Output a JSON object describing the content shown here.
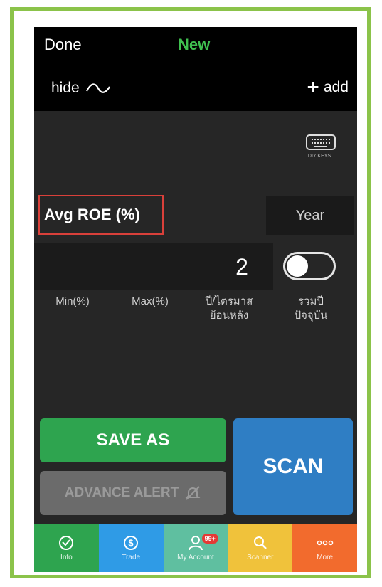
{
  "header": {
    "done_label": "Done",
    "new_label": "New",
    "hide_label": "hide",
    "add_label": "add"
  },
  "keyboard": {
    "label": "DIY KEYS"
  },
  "criteria": {
    "title": "Avg ROE (%)",
    "year_button": "Year",
    "years_value": "2",
    "toggle_on": true
  },
  "labels": {
    "min": "Min(%)",
    "max": "Max(%)",
    "years_back_line1": "ปี/ไตรมาส",
    "years_back_line2": "ย้อนหลัง",
    "include_current_line1": "รวมปี",
    "include_current_line2": "ปัจจุบัน"
  },
  "actions": {
    "save_as": "SAVE AS",
    "advance_alert": "ADVANCE ALERT",
    "scan": "SCAN"
  },
  "tabs": [
    {
      "label": "Info",
      "icon": "info-icon",
      "color": "#2ea44f"
    },
    {
      "label": "Trade",
      "icon": "dollar-icon",
      "color": "#2f9be6"
    },
    {
      "label": "My Account",
      "icon": "user-icon",
      "color": "#5fbfa0",
      "badge": "99+"
    },
    {
      "label": "Scanner",
      "icon": "search-icon",
      "color": "#f0c23b"
    },
    {
      "label": "More",
      "icon": "more-icon",
      "color": "#f26b2d"
    }
  ],
  "colors": {
    "accent_green": "#3fbf4f",
    "scan_blue": "#2f7ec4",
    "frame_green": "#8bc34a",
    "highlight_red": "#d9403a"
  }
}
